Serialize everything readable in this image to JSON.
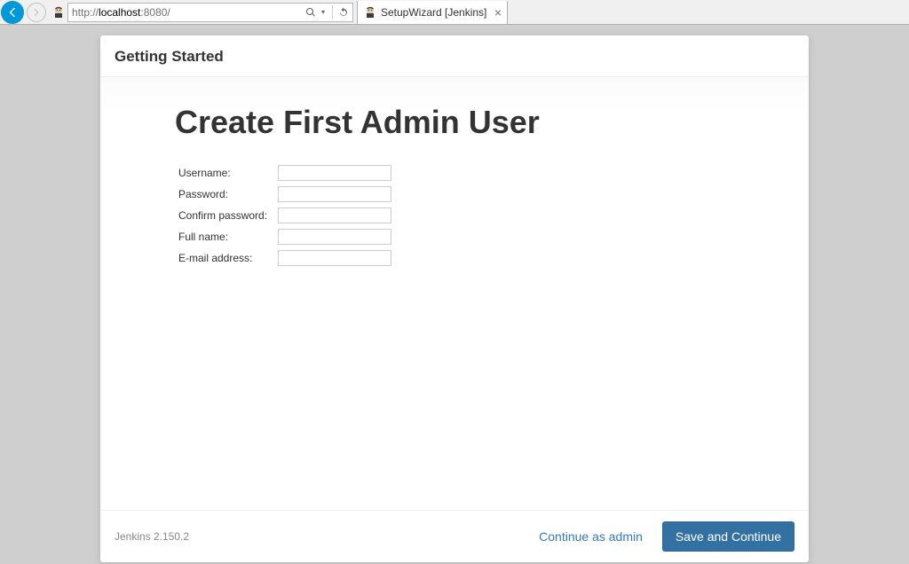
{
  "browser": {
    "url_prefix": "http://",
    "url_host": "localhost",
    "url_port": ":8080/",
    "tab_title": "SetupWizard [Jenkins]"
  },
  "modal": {
    "header": "Getting Started",
    "heading": "Create First Admin User",
    "fields": {
      "username_label": "Username:",
      "password_label": "Password:",
      "confirm_label": "Confirm password:",
      "fullname_label": "Full name:",
      "email_label": "E-mail address:"
    },
    "version": "Jenkins 2.150.2",
    "continue_as_admin": "Continue as admin",
    "save_continue": "Save and Continue"
  }
}
